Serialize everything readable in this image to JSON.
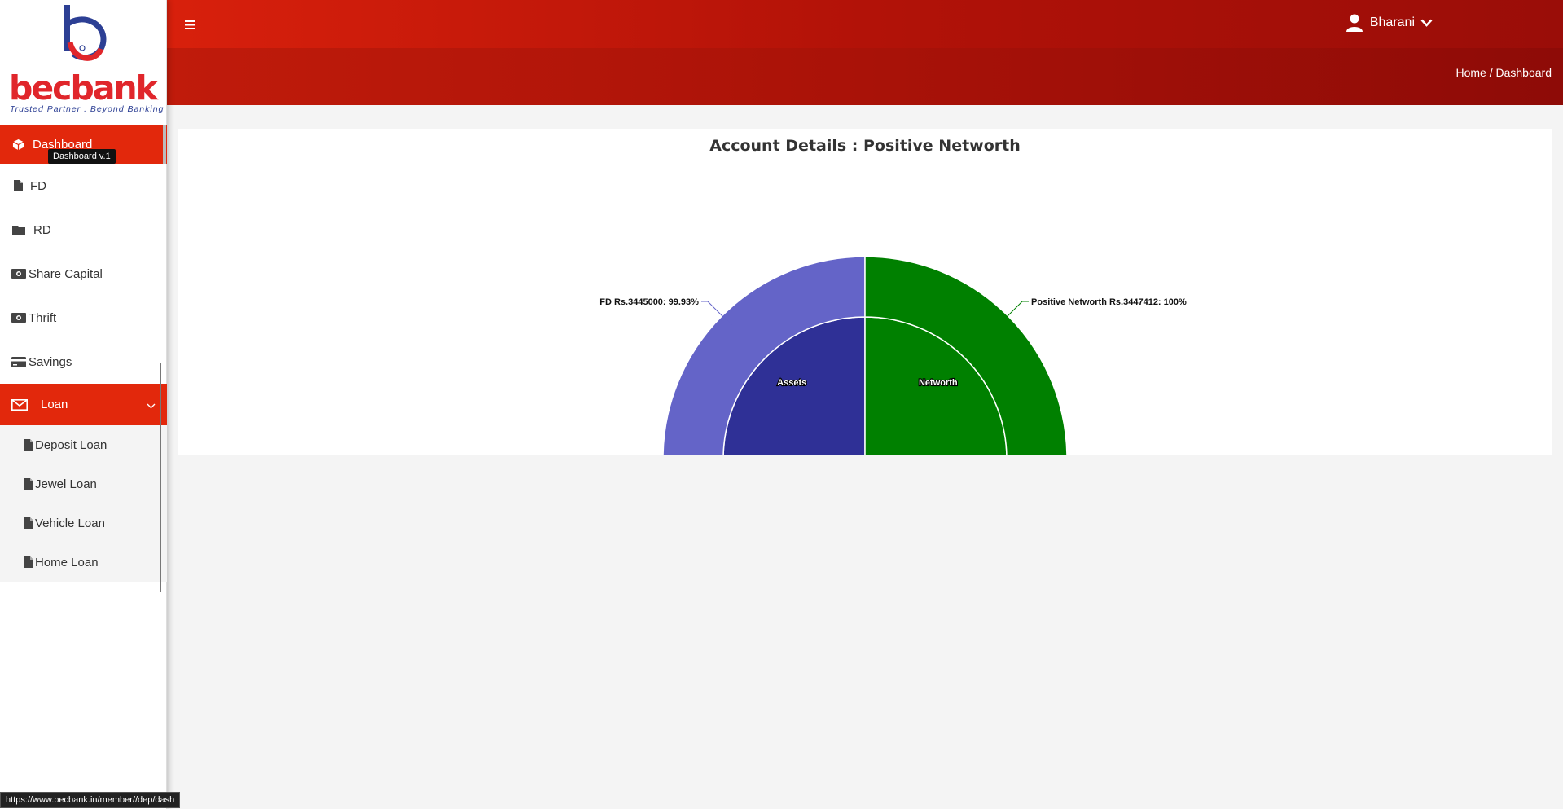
{
  "brand": {
    "name_part1": "bec",
    "name_part2": "bank",
    "tagline": "Trusted Partner . Beyond Banking",
    "colors": {
      "red": "#e0262b",
      "blue": "#2c3f94"
    }
  },
  "sidebar": {
    "items": [
      {
        "label": "Dashboard",
        "icon": "cube-icon",
        "active": true
      },
      {
        "label": "FD",
        "icon": "file-icon"
      },
      {
        "label": "RD",
        "icon": "folder-icon"
      },
      {
        "label": "Share Capital",
        "icon": "money-icon"
      },
      {
        "label": "Thrift",
        "icon": "money-icon"
      },
      {
        "label": "Savings",
        "icon": "credit-card-icon"
      },
      {
        "label": "Loan",
        "icon": "envelope-icon",
        "expanded": true
      }
    ],
    "loan_sub": [
      {
        "label": "Deposit Loan",
        "icon": "file-icon"
      },
      {
        "label": "Jewel Loan",
        "icon": "file-icon"
      },
      {
        "label": "Vehicle Loan",
        "icon": "file-icon"
      },
      {
        "label": "Home Loan",
        "icon": "file-icon"
      }
    ],
    "tooltip": "Dashboard v.1"
  },
  "header": {
    "user_name": "Bharani",
    "breadcrumb": "Home / Dashboard",
    "colors": {
      "primary": "#e2280c"
    }
  },
  "main": {
    "title": "Account Details : Positive Networth"
  },
  "chart_data": {
    "type": "pie",
    "variant": "half-donut",
    "title": "Account Details : Positive Networth",
    "inner_ring": [
      {
        "label": "Assets",
        "value": 50,
        "color": "#2f3096"
      },
      {
        "label": "Networth",
        "value": 50,
        "color": "#008000"
      }
    ],
    "outer_ring": [
      {
        "label": "FD Rs.3445000: 99.93%",
        "value": 50,
        "color": "#6464c8"
      },
      {
        "label": "Positive Networth Rs.3447412: 100%",
        "value": 50,
        "color": "#008000"
      }
    ]
  },
  "statusbar": {
    "url": "https://www.becbank.in/member//dep/dash"
  }
}
